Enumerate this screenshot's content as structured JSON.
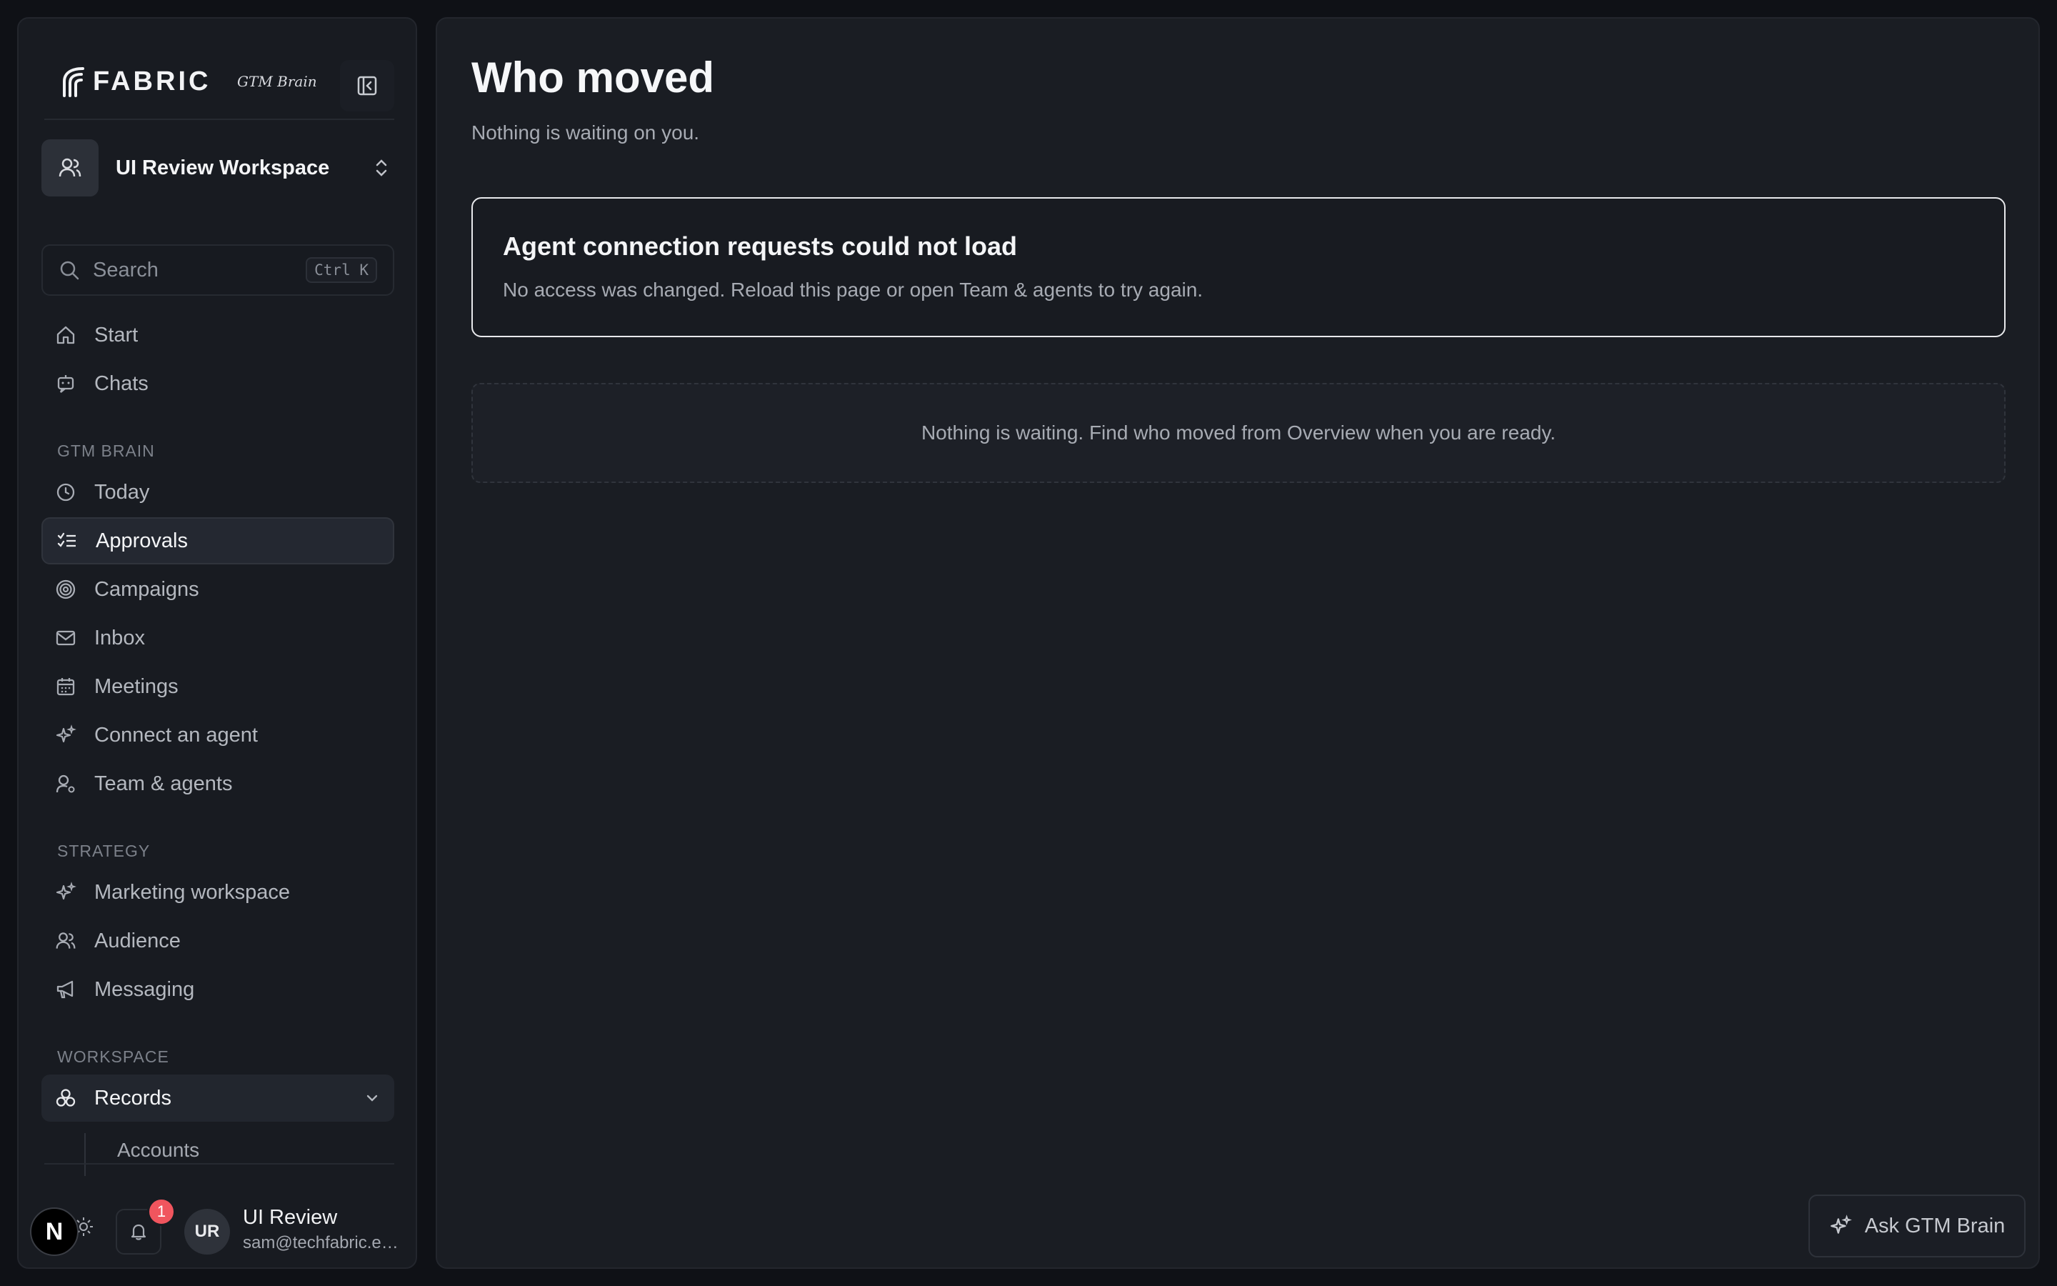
{
  "brand": {
    "wordmark": "FABRIC",
    "tagline": "GTM Brain"
  },
  "workspace": {
    "name": "UI Review Workspace"
  },
  "search": {
    "placeholder": "Search",
    "shortcut": "Ctrl K"
  },
  "nav": {
    "top": [
      {
        "label": "Start",
        "icon": "home-icon"
      },
      {
        "label": "Chats",
        "icon": "chat-icon"
      }
    ],
    "gtm_label": "GTM BRAIN",
    "gtm": [
      {
        "label": "Today",
        "icon": "clock-icon"
      },
      {
        "label": "Approvals",
        "icon": "checklist-icon",
        "active": true
      },
      {
        "label": "Campaigns",
        "icon": "target-icon"
      },
      {
        "label": "Inbox",
        "icon": "mail-icon"
      },
      {
        "label": "Meetings",
        "icon": "calendar-icon"
      },
      {
        "label": "Connect an agent",
        "icon": "sparkle-icon"
      },
      {
        "label": "Team & agents",
        "icon": "user-gear-icon"
      }
    ],
    "strategy_label": "STRATEGY",
    "strategy": [
      {
        "label": "Marketing workspace",
        "icon": "sparkle-icon"
      },
      {
        "label": "Audience",
        "icon": "users-icon"
      },
      {
        "label": "Messaging",
        "icon": "megaphone-icon"
      }
    ],
    "workspace_label": "WORKSPACE",
    "records": {
      "label": "Records",
      "icon": "records-icon"
    },
    "records_sub": [
      "Accounts"
    ]
  },
  "user": {
    "initials": "UR",
    "name": "UI Review",
    "email": "sam@techfabric.e…",
    "notifications": "1"
  },
  "next_badge": "N",
  "main": {
    "title": "Who moved",
    "subtitle": "Nothing is waiting on you.",
    "error": {
      "title": "Agent connection requests could not load",
      "text": "No access was changed. Reload this page or open Team & agents to try again."
    },
    "empty": "Nothing is waiting. Find who moved from Overview when you are ready.",
    "ask_button": "Ask GTM Brain"
  },
  "colors": {
    "background": "#0f1116",
    "panel": "#181b21",
    "main_panel": "#1a1d23",
    "badge": "#f0555e",
    "text_primary": "#f4f5f7",
    "text_muted": "#a7abb3"
  }
}
